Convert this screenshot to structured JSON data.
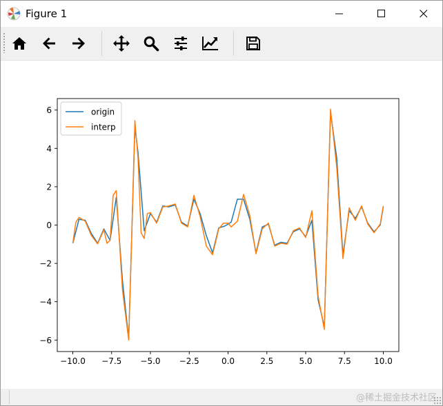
{
  "window": {
    "title": "Figure 1"
  },
  "toolbar": {
    "buttons": [
      {
        "icon": "home-icon"
      },
      {
        "icon": "back-arrow-icon"
      },
      {
        "icon": "forward-arrow-icon"
      },
      {
        "icon": "pan-icon"
      },
      {
        "icon": "zoom-icon"
      },
      {
        "icon": "configure-subplots-icon"
      },
      {
        "icon": "edit-axis-icon"
      },
      {
        "icon": "save-icon"
      }
    ]
  },
  "watermark": "@稀土掘金技术社区",
  "chart_data": {
    "type": "line",
    "title": "",
    "xlabel": "",
    "ylabel": "",
    "xlim": [
      -11,
      11
    ],
    "ylim": [
      -6.6,
      6.6
    ],
    "xticks": [
      -10.0,
      -7.5,
      -5.0,
      -2.5,
      0.0,
      2.5,
      5.0,
      7.5,
      10.0
    ],
    "xtick_labels": [
      "−10.0",
      "−7.5",
      "−5.0",
      "−2.5",
      "0.0",
      "2.5",
      "5.0",
      "7.5",
      "10.0"
    ],
    "yticks": [
      -6,
      -4,
      -2,
      0,
      2,
      4,
      6
    ],
    "ytick_labels": [
      "−6",
      "−4",
      "−2",
      "0",
      "2",
      "4",
      "6"
    ],
    "grid": false,
    "legend": {
      "placement": "top-left"
    },
    "series": [
      {
        "name": "origin",
        "color": "#1f77b4",
        "points": [
          [
            -10.0,
            -0.95
          ],
          [
            -9.6,
            0.3
          ],
          [
            -9.2,
            0.25
          ],
          [
            -8.8,
            -0.45
          ],
          [
            -8.4,
            -0.95
          ],
          [
            -8.0,
            -0.2
          ],
          [
            -7.6,
            -0.8
          ],
          [
            -7.2,
            1.45
          ],
          [
            -6.8,
            -2.9
          ],
          [
            -6.4,
            -5.95
          ],
          [
            -6.0,
            5.1
          ],
          [
            -5.8,
            3.8
          ],
          [
            -5.4,
            -0.3
          ],
          [
            -5.0,
            0.6
          ],
          [
            -4.6,
            0.15
          ],
          [
            -4.2,
            1.0
          ],
          [
            -3.8,
            0.95
          ],
          [
            -3.4,
            1.05
          ],
          [
            -3.0,
            0.15
          ],
          [
            -2.6,
            -0.05
          ],
          [
            -2.2,
            1.35
          ],
          [
            -1.8,
            0.6
          ],
          [
            -1.4,
            -0.55
          ],
          [
            -1.0,
            -1.45
          ],
          [
            -0.6,
            -0.15
          ],
          [
            -0.2,
            -0.05
          ],
          [
            0.2,
            0.15
          ],
          [
            0.6,
            1.35
          ],
          [
            1.0,
            1.35
          ],
          [
            1.4,
            0.3
          ],
          [
            1.8,
            -1.45
          ],
          [
            2.2,
            -0.1
          ],
          [
            2.6,
            0.05
          ],
          [
            3.0,
            -1.05
          ],
          [
            3.4,
            -0.9
          ],
          [
            3.8,
            -0.95
          ],
          [
            4.2,
            -0.35
          ],
          [
            4.6,
            -0.2
          ],
          [
            5.0,
            -0.6
          ],
          [
            5.4,
            0.25
          ],
          [
            5.8,
            -3.9
          ],
          [
            6.2,
            -5.3
          ],
          [
            6.6,
            5.9
          ],
          [
            7.0,
            3.5
          ],
          [
            7.4,
            -1.55
          ],
          [
            7.8,
            0.75
          ],
          [
            8.2,
            0.35
          ],
          [
            8.6,
            0.95
          ],
          [
            9.0,
            0.1
          ],
          [
            9.4,
            -0.35
          ],
          [
            9.8,
            0.0
          ],
          [
            10.0,
            0.95
          ]
        ]
      },
      {
        "name": "interp",
        "color": "#ff7f0e",
        "points": [
          [
            -10.0,
            -0.95
          ],
          [
            -9.8,
            0.15
          ],
          [
            -9.6,
            0.4
          ],
          [
            -9.2,
            0.2
          ],
          [
            -8.8,
            -0.55
          ],
          [
            -8.4,
            -0.98
          ],
          [
            -8.0,
            -0.25
          ],
          [
            -7.8,
            -0.95
          ],
          [
            -7.6,
            -0.8
          ],
          [
            -7.4,
            1.55
          ],
          [
            -7.2,
            1.8
          ],
          [
            -6.8,
            -3.4
          ],
          [
            -6.4,
            -6.0
          ],
          [
            -6.2,
            -0.5
          ],
          [
            -6.0,
            5.45
          ],
          [
            -5.8,
            3.5
          ],
          [
            -5.6,
            -0.4
          ],
          [
            -5.4,
            -0.7
          ],
          [
            -5.2,
            0.6
          ],
          [
            -5.0,
            0.65
          ],
          [
            -4.6,
            0.1
          ],
          [
            -4.2,
            0.95
          ],
          [
            -3.8,
            1.0
          ],
          [
            -3.4,
            1.1
          ],
          [
            -3.0,
            0.1
          ],
          [
            -2.6,
            -0.1
          ],
          [
            -2.2,
            1.55
          ],
          [
            -1.8,
            0.45
          ],
          [
            -1.4,
            -1.1
          ],
          [
            -1.0,
            -1.55
          ],
          [
            -0.6,
            -0.2
          ],
          [
            -0.3,
            0.1
          ],
          [
            0.0,
            0.1
          ],
          [
            0.2,
            -0.1
          ],
          [
            0.6,
            0.2
          ],
          [
            1.0,
            1.6
          ],
          [
            1.4,
            0.5
          ],
          [
            1.8,
            -1.5
          ],
          [
            2.2,
            -0.2
          ],
          [
            2.6,
            0.1
          ],
          [
            3.0,
            -1.1
          ],
          [
            3.4,
            -0.95
          ],
          [
            3.8,
            -1.0
          ],
          [
            4.2,
            -0.3
          ],
          [
            4.6,
            -0.15
          ],
          [
            5.0,
            -0.65
          ],
          [
            5.4,
            0.75
          ],
          [
            5.8,
            -3.7
          ],
          [
            6.2,
            -5.45
          ],
          [
            6.6,
            6.05
          ],
          [
            7.0,
            3.0
          ],
          [
            7.4,
            -1.75
          ],
          [
            7.8,
            0.9
          ],
          [
            8.2,
            0.25
          ],
          [
            8.6,
            1.0
          ],
          [
            9.0,
            0.05
          ],
          [
            9.4,
            -0.4
          ],
          [
            9.8,
            0.05
          ],
          [
            10.0,
            1.0
          ]
        ]
      }
    ]
  }
}
